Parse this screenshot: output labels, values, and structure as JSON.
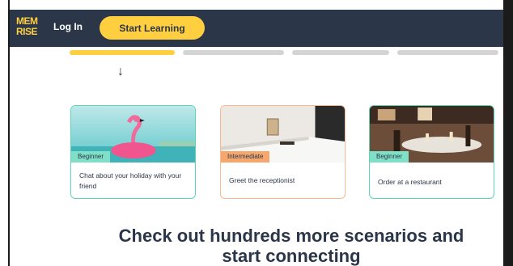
{
  "header": {
    "logo_line1": "MEM",
    "logo_line2": "RISE",
    "login_label": "Log In",
    "start_label": "Start Learning"
  },
  "arrow_glyph": "↓",
  "cards": [
    {
      "level": "Beginner",
      "title": "Chat about your holiday with your friend"
    },
    {
      "level": "Intermediate",
      "title": "Greet the receptionist"
    },
    {
      "level": "Beginner",
      "title": "Order at a restaurant"
    }
  ],
  "cta": {
    "heading": "Check out hundreds more scenarios and start connecting"
  },
  "colors": {
    "header_bg": "#2b3648",
    "accent_yellow": "#ffcf3f",
    "beginner": "#7fe0c7",
    "intermediate": "#f5a76e"
  }
}
